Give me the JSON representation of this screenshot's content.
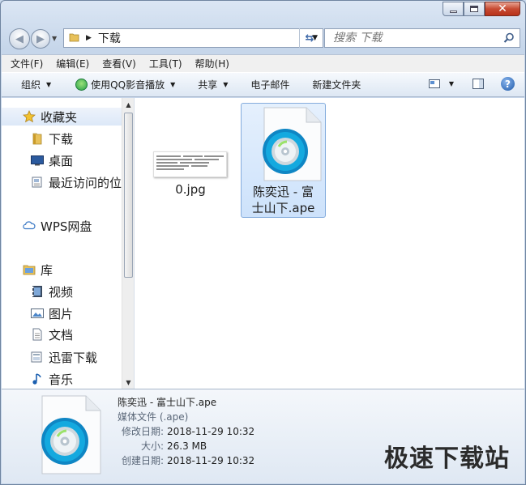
{
  "window": {
    "caption_buttons": [
      "minimize",
      "maximize",
      "close"
    ]
  },
  "address": {
    "path": "下载",
    "search_placeholder": "搜索 下载"
  },
  "menu": [
    "文件(F)",
    "编辑(E)",
    "查看(V)",
    "工具(T)",
    "帮助(H)"
  ],
  "toolbar": {
    "organize": "组织",
    "open_with": "使用QQ影音播放",
    "share": "共享",
    "email": "电子邮件",
    "new_folder": "新建文件夹"
  },
  "sidebar": {
    "favorites": "收藏夹",
    "items": [
      "下载",
      "桌面",
      "最近访问的位"
    ],
    "wps": "WPS网盘",
    "library": "库",
    "lib_items": [
      "视频",
      "图片",
      "文档",
      "迅雷下载",
      "音乐"
    ]
  },
  "files": [
    {
      "name": "0.jpg",
      "icon": "image-thumbnail"
    },
    {
      "name": "陈奕迅 - 富\n士山下.ape",
      "icon": "media-disc-icon"
    }
  ],
  "details": {
    "name": "陈奕迅 - 富士山下.ape",
    "type": "媒体文件 (.ape)",
    "modified_label": "修改日期:",
    "modified": "2018-11-29 10:32",
    "size_label": "大小:",
    "size": "26.3 MB",
    "created_label": "创建日期:",
    "created": "2018-11-29 10:32"
  },
  "watermark": "极速下载站",
  "colors": {
    "accent": "#3c67a7",
    "selection": "#cde2fb",
    "close": "#c74a32"
  }
}
